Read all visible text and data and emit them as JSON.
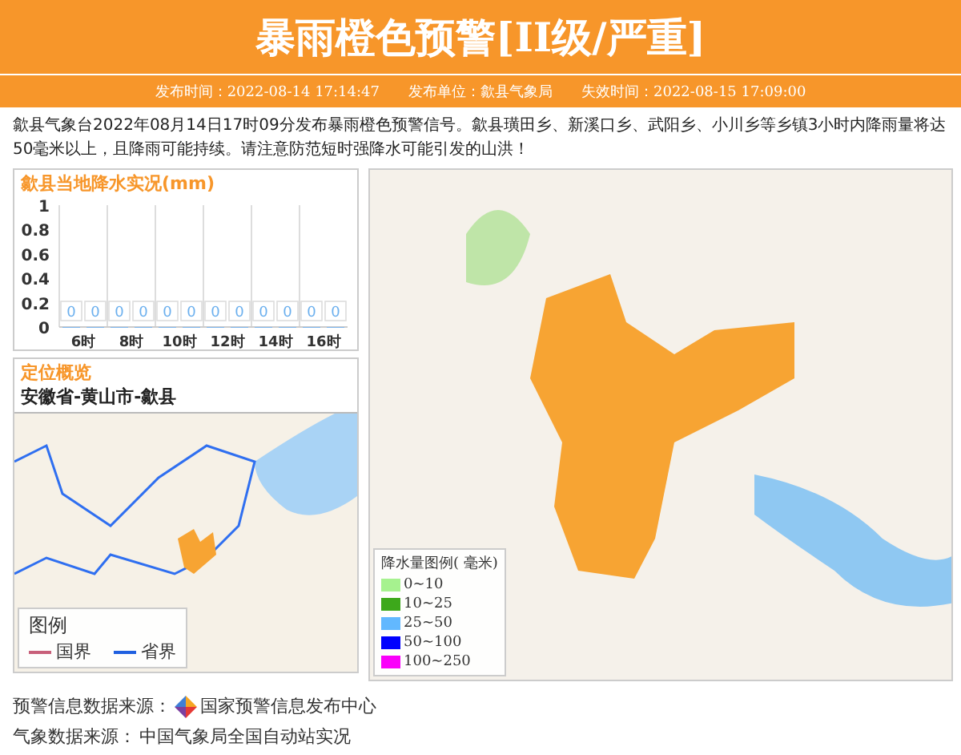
{
  "header": {
    "title": "暴雨橙色预警[II级/严重]",
    "meta": [
      {
        "label": "发布时间：",
        "value": "2022-08-14 17:14:47"
      },
      {
        "label": "发布单位：",
        "value": "歙县气象局"
      },
      {
        "label": "失效时间：",
        "value": "2022-08-15 17:09:00"
      }
    ]
  },
  "description": "歙县气象台2022年08月14日17时09分发布暴雨橙色预警信号。歙县璜田乡、新溪口乡、武阳乡、小川乡等乡镇3小时内降雨量将达50毫米以上，且降雨可能持续。请注意防范短时强降水可能引发的山洪！",
  "rain_panel": {
    "title": "歙县当地降水实况(mm)",
    "chart_data": {
      "type": "bar",
      "categories": [
        "6时",
        "8时",
        "10时",
        "12时",
        "14时",
        "16时"
      ],
      "series": [
        {
          "color": "#7cb5ec",
          "values": [
            0,
            0,
            0,
            0,
            0,
            0
          ]
        },
        {
          "color": "#7cb5ec",
          "values": [
            0,
            0,
            0,
            0,
            0,
            0
          ]
        }
      ],
      "ylim": [
        0,
        1
      ],
      "yticks": [
        0,
        0.2,
        0.4,
        0.6,
        0.8,
        1
      ],
      "data_labels": true
    }
  },
  "location_panel": {
    "title": "定位概览",
    "path": "安徽省-黄山市-歙县",
    "legend": {
      "title": "图例",
      "items": [
        {
          "label": "国界",
          "color": "#c8607a"
        },
        {
          "label": "省界",
          "color": "#2060e0"
        }
      ]
    }
  },
  "rain_legend": {
    "title": "降水量图例( 毫米)",
    "items": [
      {
        "label": "0~10",
        "color": "#a6f28f"
      },
      {
        "label": "10~25",
        "color": "#3da81b"
      },
      {
        "label": "25~50",
        "color": "#62b8ff"
      },
      {
        "label": "50~100",
        "color": "#0000fe"
      },
      {
        "label": "100~250",
        "color": "#fa00fa"
      }
    ]
  },
  "sources": [
    {
      "label": "预警信息数据来源：",
      "value": "国家预警信息发布中心",
      "logo": true
    },
    {
      "label": "气象数据来源：",
      "value": "中国气象局全国自动站实况",
      "logo": false
    }
  ]
}
